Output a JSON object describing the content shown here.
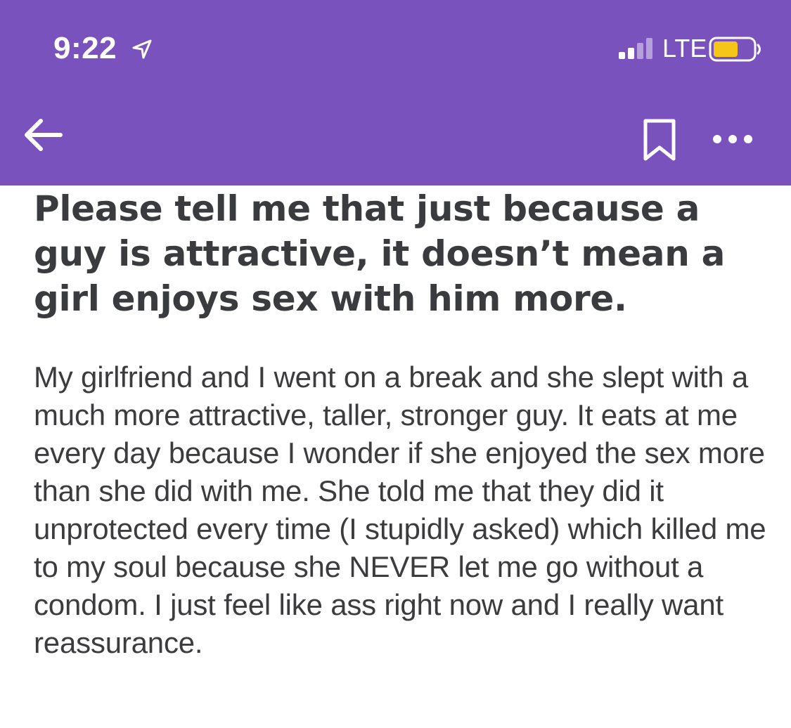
{
  "status_bar": {
    "time": "9:22",
    "network": "LTE",
    "icons": [
      "location-arrow-icon",
      "signal-bars-icon",
      "battery-icon"
    ],
    "battery_color": "#f5c518"
  },
  "toolbar": {
    "background": "#7a52be",
    "icons": [
      "back-arrow-icon",
      "bookmark-icon",
      "more-dots-icon"
    ]
  },
  "post": {
    "title": "Please tell me that just because a guy is attractive, it doesn’t mean a girl enjoys sex with him more.",
    "body": "My girlfriend and I went on a break and she slept with a much more attractive, taller, stronger guy. It eats at me every day because I wonder if she enjoyed the sex more than she did with me. She told me that they did it unprotected every time (I stupidly asked) which killed me to my soul because she NEVER let me go without a condom. I just feel like ass right now and I really want reassurance."
  }
}
